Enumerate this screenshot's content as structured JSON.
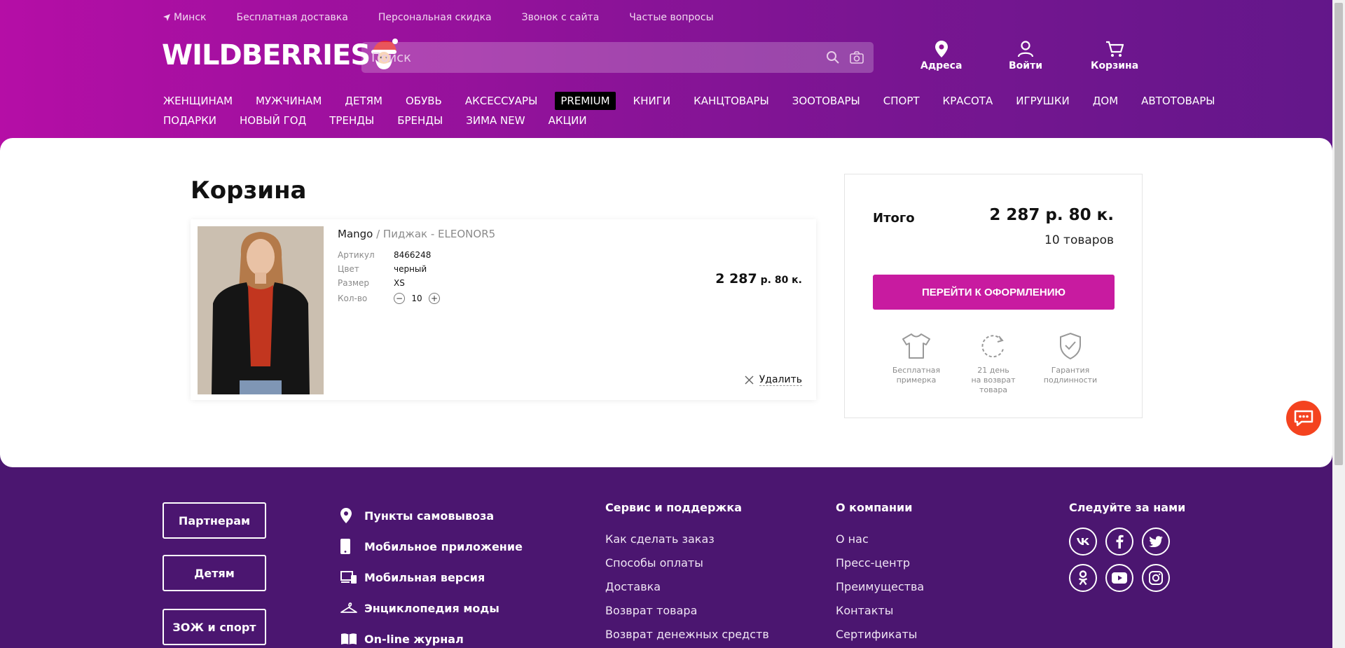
{
  "topnav": {
    "location": "Минск",
    "links": [
      "Бесплатная доставка",
      "Персональная скидка",
      "Звонок с сайта",
      "Частые вопросы"
    ]
  },
  "logo": {
    "text": "WILDBERRIES"
  },
  "search": {
    "placeholder": "Поиск"
  },
  "header_actions": {
    "addresses": "Адреса",
    "login": "Войти",
    "cart": "Корзина"
  },
  "categories": {
    "row1": [
      "ЖЕНЩИНАМ",
      "МУЖЧИНАМ",
      "ДЕТЯМ",
      "ОБУВЬ",
      "АКСЕССУАРЫ",
      "PREMIUM",
      "КНИГИ",
      "КАНЦТОВАРЫ",
      "ЗООТОВАРЫ",
      "СПОРТ",
      "КРАСОТА",
      "ИГРУШКИ",
      "ДОМ",
      "АВТОТОВАРЫ"
    ],
    "row2": [
      "ПОДАРКИ",
      "НОВЫЙ ГОД",
      "ТРЕНДЫ",
      "БРЕНДЫ",
      "ЗИМА NEW",
      "АКЦИИ"
    ]
  },
  "cart": {
    "title": "Корзина",
    "item": {
      "brand": "Mango",
      "name": " / Пиджак - ELEONOR5",
      "props": [
        {
          "key": "Артикул",
          "value": "8466248"
        },
        {
          "key": "Цвет",
          "value": "черный"
        },
        {
          "key": "Размер",
          "value": "XS"
        }
      ],
      "qty_label": "Кол-во",
      "qty": "10",
      "price_main": "2 287",
      "price_rest": " р. 80 к.",
      "delete": "Удалить"
    }
  },
  "summary": {
    "label": "Итого",
    "total": "2 287 р. 80 к.",
    "count": "10 товаров",
    "checkout": "ПЕРЕЙТИ К ОФОРМЛЕНИЮ",
    "perks": [
      {
        "icon": "tshirt-icon",
        "line1": "Бесплатная",
        "line2": "примерка",
        "line3": ""
      },
      {
        "icon": "refresh-icon",
        "line1": "21 день",
        "line2": "на возврат",
        "line3": "товара"
      },
      {
        "icon": "shield-check-icon",
        "line1": "Гарантия",
        "line2": "подлинности",
        "line3": ""
      }
    ]
  },
  "footer": {
    "buttons": [
      "Партнерам",
      "Детям",
      "ЗОЖ и спорт"
    ],
    "icon_links": [
      {
        "icon": "map-pin-icon",
        "label": "Пункты самовывоза"
      },
      {
        "icon": "phone-icon",
        "label": "Мобильное приложение"
      },
      {
        "icon": "devices-icon",
        "label": "Мобильная версия"
      },
      {
        "icon": "hanger-icon",
        "label": "Энциклопедия моды"
      },
      {
        "icon": "book-icon",
        "label": "On-line журнал"
      }
    ],
    "service": {
      "title": "Сервис и поддержка",
      "links": [
        "Как сделать заказ",
        "Способы оплаты",
        "Доставка",
        "Возврат товара",
        "Возврат денежных средств"
      ]
    },
    "company": {
      "title": "О компании",
      "links": [
        "О нас",
        "Пресс-центр",
        "Преимущества",
        "Контакты",
        "Сертификаты"
      ]
    },
    "social": {
      "title": "Следуйте за нами",
      "icons": [
        "vk-icon",
        "facebook-icon",
        "twitter-icon",
        "odnoklassniki-icon",
        "youtube-icon",
        "instagram-icon"
      ]
    }
  },
  "colors": {
    "header_start": "#b50ea6",
    "header_end": "#63178a",
    "footer_bg": "#4b1670",
    "checkout": "#c81ba0",
    "chat": "#f4431f"
  }
}
